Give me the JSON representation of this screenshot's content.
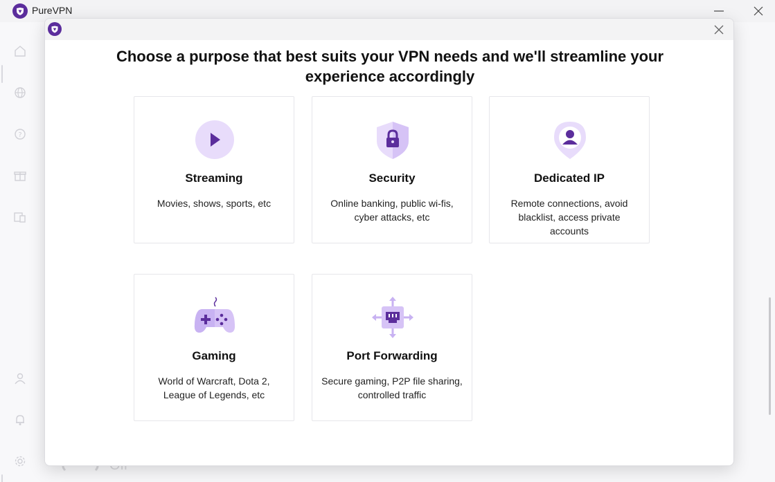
{
  "app": {
    "title": "PureVPN"
  },
  "background": {
    "toggle_label": "Off"
  },
  "modal": {
    "heading": "Choose a purpose that best suits your VPN needs and we'll streamline your experience accordingly",
    "cards": [
      {
        "title": "Streaming",
        "description": "Movies, shows, sports, etc",
        "icon": "play-icon"
      },
      {
        "title": "Security",
        "description": "Online banking, public wi-fis, cyber attacks, etc",
        "icon": "shield-lock-icon"
      },
      {
        "title": "Dedicated IP",
        "description": "Remote connections, avoid blacklist, access private accounts",
        "icon": "user-pin-icon"
      },
      {
        "title": "Gaming",
        "description": "World of Warcraft, Dota 2, League of Legends, etc",
        "icon": "gamepad-icon"
      },
      {
        "title": "Port Forwarding",
        "description": "Secure gaming, P2P file sharing, controlled traffic",
        "icon": "port-forwarding-icon"
      }
    ]
  },
  "colors": {
    "accent": "#5b2d9c",
    "accent_light": "#e8dcfb",
    "accent_mid": "#c8b2f2"
  }
}
